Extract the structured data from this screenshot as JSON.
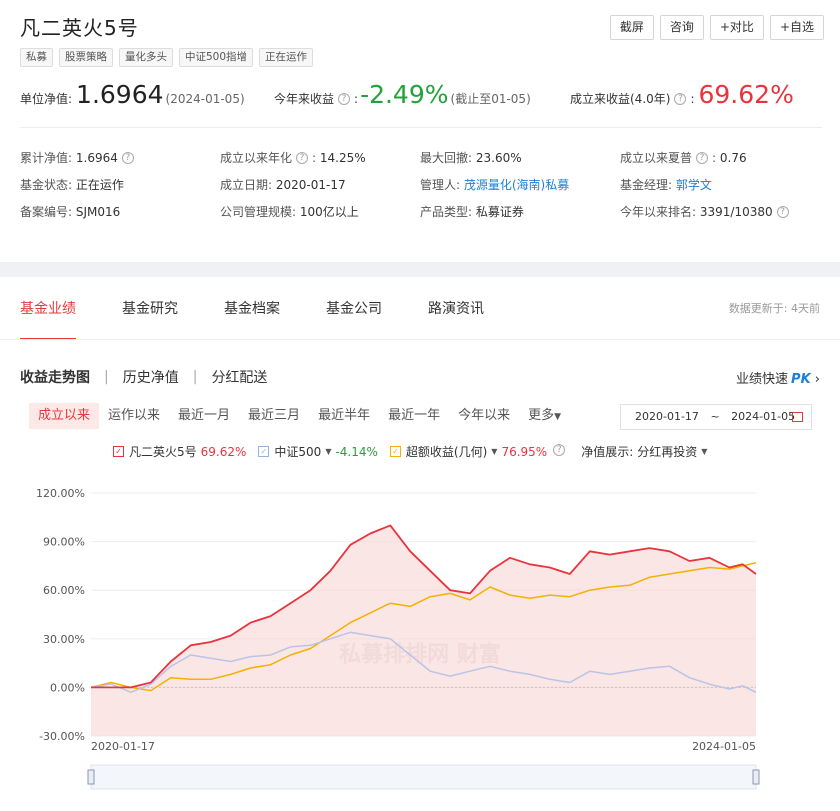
{
  "fund": {
    "title": "凡二英火5号",
    "tags": [
      "私募",
      "股票策略",
      "量化多头",
      "中证500指增",
      "正在运作"
    ],
    "actions": [
      "截屏",
      "咨询",
      "+对比",
      "+自选"
    ]
  },
  "kpis": {
    "nav_label": "单位净值:",
    "nav_value": "1.6964",
    "nav_date": "(2024-01-05)",
    "ytd_label": "今年来收益",
    "ytd_value": "-2.49%",
    "ytd_note": "(截止至01-05)",
    "since_label": "成立来收益(4.0年)",
    "since_value": "69.62%"
  },
  "info": [
    [
      {
        "label": "累计净值:",
        "value": "1.6964",
        "help": true
      },
      {
        "label": "成立以来年化",
        "value": "14.25%",
        "help": true,
        "colon": true
      },
      {
        "label": "最大回撤:",
        "value": "23.60%"
      },
      {
        "label": "成立以来夏普",
        "value": "0.76",
        "help": true,
        "colon": true
      }
    ],
    [
      {
        "label": "基金状态:",
        "value": "正在运作"
      },
      {
        "label": "成立日期:",
        "value": "2020-01-17"
      },
      {
        "label": "管理人:",
        "value": "茂源量化(海南)私募",
        "link": true
      },
      {
        "label": "基金经理:",
        "value": "郭学文",
        "link": true
      }
    ],
    [
      {
        "label": "备案编号:",
        "value": "SJM016"
      },
      {
        "label": "公司管理规模:",
        "value": "100亿以上"
      },
      {
        "label": "产品类型:",
        "value": "私募证券"
      },
      {
        "label": "今年以来排名:",
        "value": "3391/10380",
        "help": true,
        "helpAfter": true
      }
    ]
  ],
  "tabs": [
    "基金业绩",
    "基金研究",
    "基金档案",
    "基金公司",
    "路演资讯"
  ],
  "update_note": "数据更新于: 4天前",
  "subtabs": [
    "收益走势图",
    "历史净值",
    "分红配送"
  ],
  "quick": {
    "label": "业绩快速",
    "pk": "PK"
  },
  "periods": [
    "成立以来",
    "运作以来",
    "最近一月",
    "最近三月",
    "最近半年",
    "最近一年",
    "今年以来",
    "更多"
  ],
  "date_range": {
    "start": "2020-01-17",
    "sep": "~",
    "end": "2024-01-05"
  },
  "legend": [
    {
      "name": "凡二英火5号",
      "value": "69.62%",
      "color": "#e8343d",
      "valueColor": "#e8343d",
      "dropdown": false
    },
    {
      "name": "中证500",
      "value": "-4.14%",
      "color": "#93b6e0",
      "valueColor": "#2a9d3c",
      "dropdown": true
    },
    {
      "name": "超额收益(几何)",
      "value": "76.95%",
      "color": "#f4b100",
      "valueColor": "#e8343d",
      "dropdown": true
    }
  ],
  "nav_mode": {
    "label": "净值展示:",
    "value": "分红再投资"
  },
  "watermark": "私募排排网 财富",
  "chart_data": {
    "type": "line",
    "x_start": "2020-01-17",
    "x_end": "2024-01-05",
    "ylim": [
      -30,
      120
    ],
    "yticks": [
      "120.00%",
      "90.00%",
      "60.00%",
      "30.00%",
      "0.00%",
      "-30.00%"
    ],
    "ytick_values": [
      120,
      90,
      60,
      30,
      0,
      -30
    ],
    "xtick_labels": [
      "2020-01-17",
      "2024-01-05"
    ],
    "x": [
      0,
      0.03,
      0.06,
      0.09,
      0.12,
      0.15,
      0.18,
      0.21,
      0.24,
      0.27,
      0.3,
      0.33,
      0.36,
      0.39,
      0.42,
      0.45,
      0.48,
      0.51,
      0.54,
      0.57,
      0.6,
      0.63,
      0.66,
      0.69,
      0.72,
      0.75,
      0.78,
      0.81,
      0.84,
      0.87,
      0.9,
      0.93,
      0.96,
      0.98,
      1.0
    ],
    "series": [
      {
        "name": "凡二英火5号",
        "color": "#e8343d",
        "fill": true,
        "values": [
          0,
          0,
          0,
          3,
          16,
          26,
          28,
          32,
          40,
          44,
          52,
          60,
          72,
          88,
          95,
          100,
          84,
          72,
          60,
          58,
          72,
          80,
          76,
          74,
          70,
          84,
          82,
          84,
          86,
          84,
          78,
          80,
          74,
          76,
          70
        ]
      },
      {
        "name": "中证500",
        "color": "#b9c4e6",
        "fill": false,
        "values": [
          0,
          2,
          -3,
          2,
          13,
          20,
          18,
          16,
          19,
          20,
          25,
          26,
          30,
          34,
          32,
          30,
          20,
          10,
          7,
          10,
          13,
          10,
          8,
          5,
          3,
          10,
          8,
          10,
          12,
          13,
          6,
          2,
          -1,
          1,
          -3
        ]
      },
      {
        "name": "超额收益(几何)",
        "color": "#f4b100",
        "fill": false,
        "values": [
          0,
          3,
          0,
          -2,
          6,
          5,
          5,
          8,
          12,
          14,
          20,
          24,
          32,
          40,
          46,
          52,
          50,
          56,
          58,
          54,
          62,
          57,
          55,
          57,
          56,
          60,
          62,
          63,
          68,
          70,
          72,
          74,
          73,
          75,
          77
        ]
      }
    ]
  }
}
